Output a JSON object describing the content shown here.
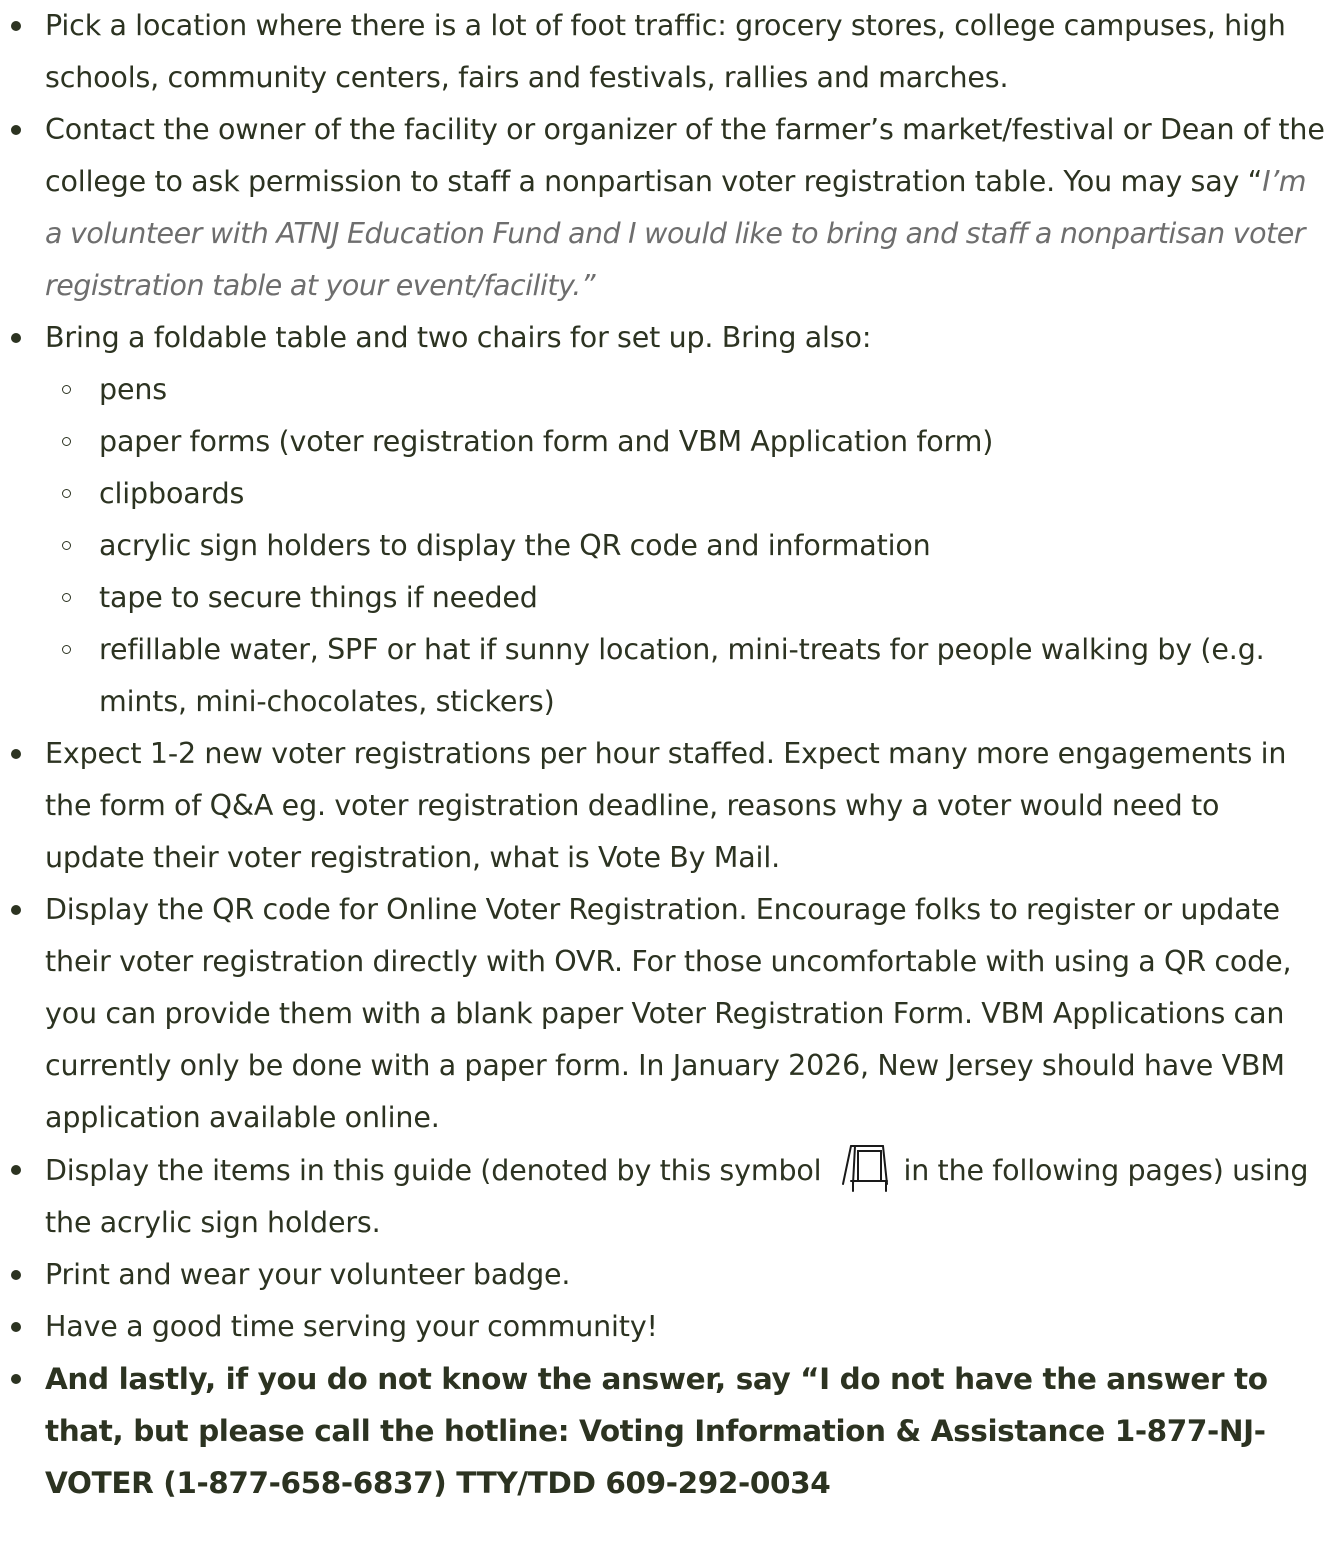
{
  "items": [
    {
      "text": "Pick a location where there is a lot of foot traffic: grocery stores, college campuses, high schools, community centers, fairs and festivals, rallies and marches."
    },
    {
      "text_before": "Contact the owner of the facility or organizer of the farmer’s market/festival or Dean of the college to ask permission to staff a nonpartisan voter registration table. You may say “",
      "quote": "I’m a volunteer with ATNJ Education Fund and I would like to bring and staff a nonpartisan voter registration table at your event/facility.",
      "text_after": "”"
    },
    {
      "text": "Bring a foldable table and two chairs for set up. Bring also:",
      "subitems": [
        "pens",
        "paper forms (voter registration form and VBM Application form)",
        "clipboards",
        "acrylic sign holders to display the QR code and information",
        "tape to secure things if needed",
        "refillable water, SPF or hat if sunny location, mini-treats for people walking by (e.g. mints, mini-chocolates, stickers)"
      ]
    },
    {
      "text": "Expect 1-2 new voter registrations per hour staffed. Expect many more engagements in the form of Q&A eg. voter registration deadline, reasons why a voter would need to update their voter registration, what is Vote By Mail."
    },
    {
      "text": "Display the QR code for Online Voter Registration. Encourage folks to register or update their voter registration directly with OVR. For those uncomfortable with using a QR code, you can provide them with a blank paper Voter Registration Form. VBM Applications can currently only be done with a paper form. In January 2026, New Jersey should have VBM application available online."
    },
    {
      "text_before": "Display the items in this guide (denoted by this symbol",
      "icon": "sign-holder-icon",
      "text_after": "in the following pages) using the acrylic sign holders."
    },
    {
      "text": "Print and wear your volunteer badge."
    },
    {
      "text": "Have a good time serving your community!"
    },
    {
      "text": "And lastly, if you do not know the answer, say “I do not have the answer to that, but please call the hotline:  Voting Information & Assistance 1-877-NJ-VOTER (1-877-658-6837) TTY/TDD 609-292-0034"
    }
  ],
  "colors": {
    "text": "#2c3321",
    "quote": "#6e6e6e",
    "background": "#ffffff"
  }
}
